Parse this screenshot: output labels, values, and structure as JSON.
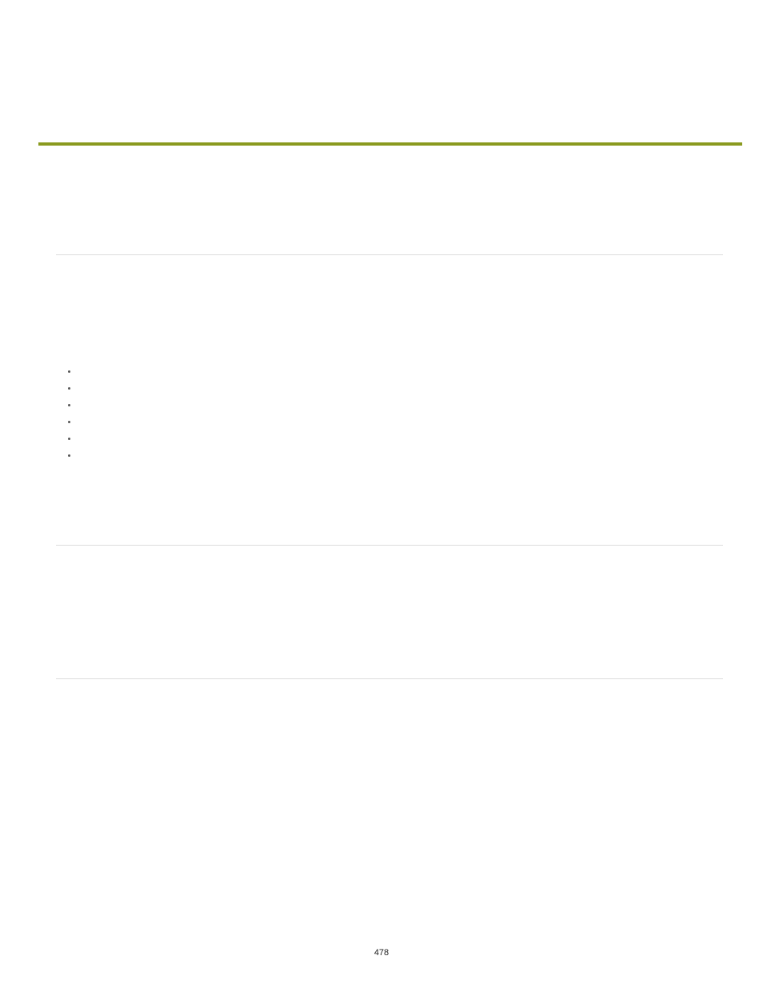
{
  "page_number": "478",
  "rules": {
    "accent": "#8a9a1f"
  },
  "bullets": [
    "",
    "",
    "",
    "",
    "",
    ""
  ]
}
